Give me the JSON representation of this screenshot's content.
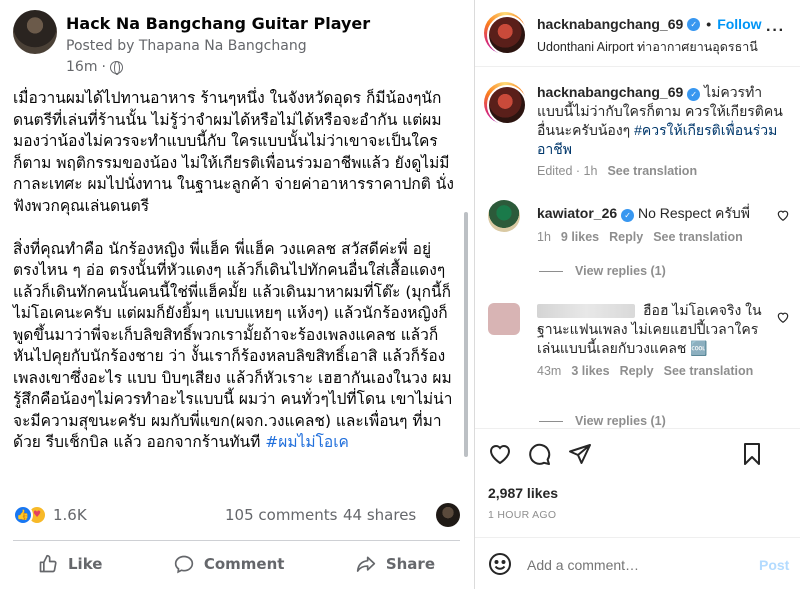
{
  "facebook": {
    "page_name": "Hack Na Bangchang Guitar Player",
    "posted_by": "Posted by Thapana Na Bangchang",
    "time": "16m",
    "dot": "·",
    "post_lines_1": [
      "เมื่อวานผมได้ไปทานอาหาร ร้านๆหนึ่ง ในจังหวัดอุดร ก็มีน้องๆนัก",
      "ดนตรีที่เล่นที่ร้านนั้น ไม่รู้ว่าจำผมได้หรือไม่ได้หรือจะอำกัน แต่ผม",
      "มองว่าน้องไม่ควรจะทำแบบนี้กับ ใครแบบนั้นไม่ว่าเขาจะเป็นใคร",
      "ก็ตาม พฤติกรรมของน้อง ไม่ให้เกียรติเพื่อนร่วมอาชีพแล้ว ยังดูไม่มี",
      "กาละเทศะ ผมไปนั่งทาน ในฐานะลูกค้า จ่ายค่าอาหารราคาปกติ นั่ง",
      "ฟังพวกคุณเล่นดนตรี"
    ],
    "post_lines_2": [
      "สิ่งที่คุณทำคือ นักร้องหญิง พี่แฮ็ค พี่แฮ็ค วงแคลช สวัสดีค่ะพี่ อยู่",
      "ตรงไหน ๆ อ่อ ตรงนั้นที่หัวแดงๆ แล้วก็เดินไปทักคนอื่นใส่เสื้อแดงๆ",
      "แล้วก็เดินทักคนนั้นคนนี้ใช่พี่แฮ็คมั้ย แล้วเดินมาหาผมที่โต๊ะ (มุกนี้ก็",
      "ไม่โอเคนะครับ แต่ผมก็ยังยิ้มๆ แบบแหยๆ แห้งๆ) แล้วนักร้องหญิงก็",
      "พูดขึ้นมาว่าพี่จะเก็บลิขสิทธิ์พวกเรามั้ยถ้าจะร้องเพลงแคลช แล้วก็",
      "หันไปคุยกับนักร้องชาย ว่า งั้นเราก็ร้องหลบลิขสิทธิ์เอาสิ แล้วก็ร้อง",
      "เพลงเขาซึ่งอะไร แบบ บิบๆเสียง แล้วก็หัวเราะ เฮฮากันเองในวง ผม",
      "รู้สึกคือน้องๆไม่ควรทำอะไรแบบนี้ ผมว่า คนทั่วๆไปที่โดน เขาไม่น่า",
      "จะมีความสุขนะครับ ผมกับพี่แขก(ผจก.วงแคลช) และเพื่อนๆ ที่มา"
    ],
    "post_last_line": "ด้วย รีบเช็กบิล แล้ว ออกจากร้านทันที ",
    "hashtag": "#ผมไม่โอเค",
    "reactions_count": "1.6K",
    "comments_count": "105 comments",
    "shares_count": "44 shares",
    "actions": {
      "like": "Like",
      "comment": "Comment",
      "share": "Share"
    }
  },
  "instagram": {
    "username": "hacknabangchang_69",
    "separator": "•",
    "follow": "Follow",
    "location": "Udonthani Airport ท่าอากาศยานอุดรธานี",
    "caption": {
      "username": "hacknabangchang_69",
      "text_1": "ไม่ควรทำ",
      "text_2": "แบบนี้ไม่ว่ากับใครก็ตาม ควรให้เกียรติคน",
      "text_3": "อื่นนะครับน้องๆ ",
      "tag_1": "#ควรให้เกียรติเพื่อนร่วม",
      "tag_2": "อาชีพ",
      "edited": "Edited · 1h",
      "see_translation": "See translation"
    },
    "comments": [
      {
        "username": "kawiator_26",
        "text": "No Respect ครับพี่",
        "time": "1h",
        "likes": "9 likes",
        "reply": "Reply",
        "see_translation": "See translation",
        "view_replies": "View replies (1)"
      },
      {
        "text_1": "ฮือฮ ไม่โอเคจริง ใน",
        "text_2": "ฐานะแฟนเพลง ไม่เคยแฮปปี้เวลาใคร",
        "text_3": "เล่นแบบนี้เลยกับวงแคลช 🆒",
        "time": "43m",
        "likes": "3 likes",
        "reply": "Reply",
        "see_translation": "See translation",
        "view_replies": "View replies (1)"
      }
    ],
    "likes_count": "2,987 likes",
    "posted_ago": "1 HOUR AGO",
    "add_comment_placeholder": "Add a comment…",
    "post_button": "Post"
  },
  "colors": {
    "fb_blue": "#1877f2",
    "fb_hashtag": "#216fdb",
    "ig_follow": "#0095f6",
    "ig_tag": "#00376b",
    "muted": "#65676b"
  },
  "icons": [
    "globe-icon",
    "like-reaction-icon",
    "care-reaction-icon",
    "thumbs-up-icon",
    "comment-icon",
    "share-icon",
    "verified-badge-icon",
    "more-icon",
    "heart-icon",
    "speech-bubble-icon",
    "send-icon",
    "bookmark-icon",
    "emoji-icon"
  ]
}
